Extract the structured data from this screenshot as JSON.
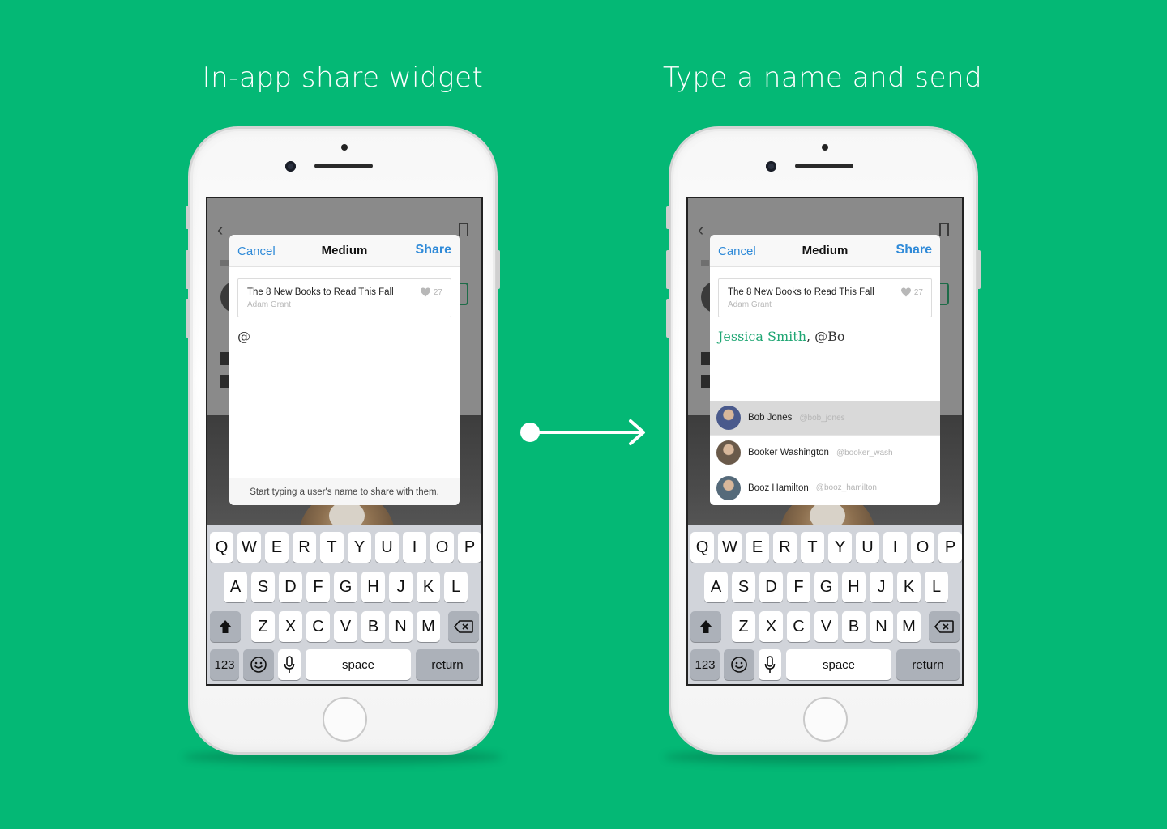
{
  "panels": [
    {
      "title": "In-app share widget",
      "sheet": {
        "cancel": "Cancel",
        "title": "Medium",
        "share": "Share",
        "story": {
          "title": "The 8 New Books to Read This Fall",
          "author": "Adam Grant",
          "likes": "27"
        },
        "compose": {
          "text": "@"
        },
        "hint": "Start typing a user's name to share with them."
      }
    },
    {
      "title": "Type a name and send",
      "sheet": {
        "cancel": "Cancel",
        "title": "Medium",
        "share": "Share",
        "story": {
          "title": "The 8 New Books to Read This Fall",
          "author": "Adam Grant",
          "likes": "27"
        },
        "compose": {
          "mention": "Jessica Smith",
          "rest": ", @Bo"
        },
        "suggestions": [
          {
            "name": "Bob Jones",
            "handle": "@bob_jones",
            "selected": true,
            "avatar_color": "#4a5a8c"
          },
          {
            "name": "Booker Washington",
            "handle": "@booker_wash",
            "selected": false,
            "avatar_color": "#6a5a4a"
          },
          {
            "name": "Booz Hamilton",
            "handle": "@booz_hamilton",
            "selected": false,
            "avatar_color": "#556a7a"
          }
        ]
      }
    }
  ],
  "keyboard": {
    "row1": [
      "Q",
      "W",
      "E",
      "R",
      "T",
      "Y",
      "U",
      "I",
      "O",
      "P"
    ],
    "row2": [
      "A",
      "S",
      "D",
      "F",
      "G",
      "H",
      "J",
      "K",
      "L"
    ],
    "row3": [
      "Z",
      "X",
      "C",
      "V",
      "B",
      "N",
      "M"
    ],
    "numbers_key": "123",
    "space_key": "space",
    "return_key": "return",
    "icons": {
      "shift": "shift-icon",
      "delete": "delete-icon",
      "emoji": "emoji-icon",
      "mic": "microphone-icon"
    }
  },
  "colors": {
    "background": "#04b875",
    "link_blue": "#2f8ad8",
    "mention_green": "#1fa673"
  }
}
